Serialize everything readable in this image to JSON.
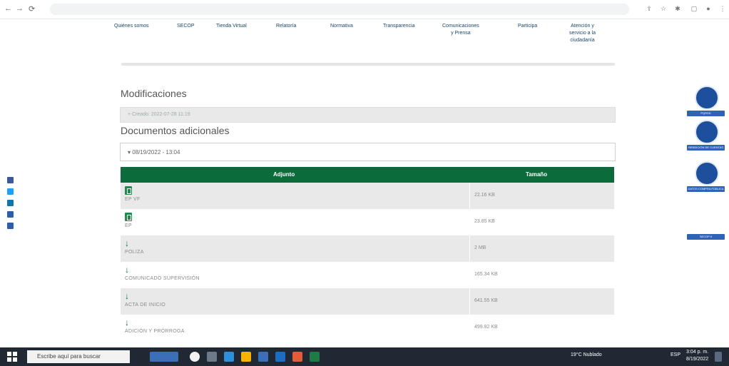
{
  "browser": {
    "back": "←",
    "forward": "→",
    "reload": "⟳"
  },
  "nav": {
    "items": [
      "Quiénes somos",
      "SECOP",
      "Tienda Virtual",
      "Relatoría",
      "Normativa",
      "Transparencia",
      "Comunicaciones\ny Prensa",
      "Participa",
      "Atención y\nservicio a la\nciudadanía"
    ]
  },
  "modificaciones": {
    "title": "Modificaciones",
    "collapsed_label": "+ Creado: 2022-07-28 11:19"
  },
  "docs": {
    "title": "Documentos adicionales",
    "expanded_label": "▾ 08/19/2022 - 13:04"
  },
  "table": {
    "col_adjunto": "Adjunto",
    "col_tamano": "Tamaño",
    "rows": [
      {
        "name": "EP VF",
        "size": "22.16 KB",
        "icon": "excel-icon"
      },
      {
        "name": "EP",
        "size": "23.85 KB",
        "icon": "excel-icon"
      },
      {
        "name": "POLIZA",
        "size": "2 MB",
        "icon": "download-icon"
      },
      {
        "name": "COMUNICADO SUPERVISIÓN",
        "size": "165.34 KB",
        "icon": "download-icon"
      },
      {
        "name": "ACTA DE INICIO",
        "size": "641.55 KB",
        "icon": "download-icon"
      },
      {
        "name": "ADICIÓN Y PRÓRROGA",
        "size": "499.92 KB",
        "icon": "download-icon"
      }
    ]
  },
  "floating": {
    "btn1_label": "PQRSD",
    "btn2_label": "RENDICIÓN DE CUENTAS",
    "btn3_label": "DATOS COMPRA PÚBLICA",
    "btn4_label": "SECOP II"
  },
  "taskbar": {
    "search_placeholder": "Escribe aquí para buscar",
    "weather": "19°C Nublado",
    "lang": "ESP",
    "time": "3:04 p. m.",
    "date": "8/19/2022"
  },
  "colors": {
    "table_header": "#0b6b3a",
    "nav_text": "#18466d",
    "floating": "#1d4f9d"
  }
}
